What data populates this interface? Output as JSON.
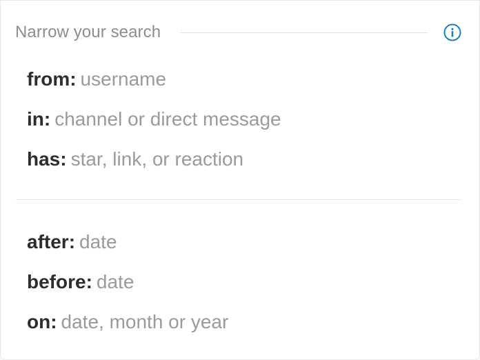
{
  "header": {
    "title": "Narrow your search",
    "info_icon": "info-circle-icon"
  },
  "colors": {
    "accent": "#1d7fbf",
    "modifier": "#2c2d30",
    "hint": "#9a9a9a",
    "title": "#8d8d8d"
  },
  "filters": [
    {
      "modifier": "from:",
      "hint": "username"
    },
    {
      "modifier": "in:",
      "hint": "channel or direct message"
    },
    {
      "modifier": "has:",
      "hint": "star, link, or reaction"
    }
  ],
  "date_filters": [
    {
      "modifier": "after:",
      "hint": "date"
    },
    {
      "modifier": "before:",
      "hint": "date"
    },
    {
      "modifier": "on:",
      "hint": "date, month or year"
    }
  ]
}
